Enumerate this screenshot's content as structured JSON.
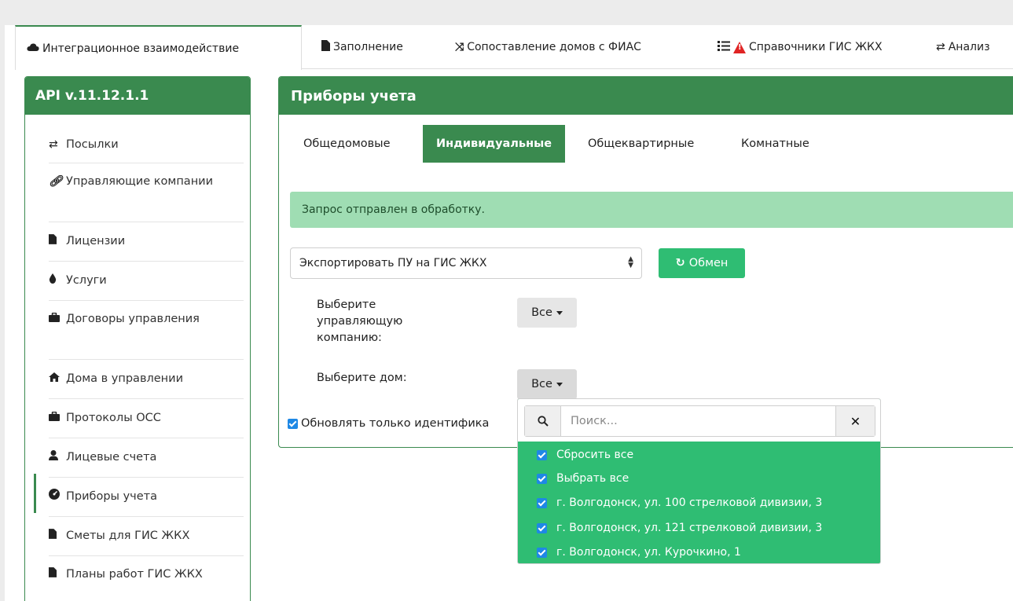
{
  "tabs": [
    {
      "label": "Интеграционное взаимодействие",
      "icon": "cloud-icon"
    },
    {
      "label": "Заполнение",
      "icon": "file-icon"
    },
    {
      "label": "Сопоставление домов с ФИАС",
      "icon": "shuffle-icon"
    },
    {
      "label": "Справочники ГИС ЖКХ",
      "icon": "list-warning-icon"
    },
    {
      "label": "Анализ",
      "icon": "exchange-icon"
    }
  ],
  "sidebar": {
    "title": "API v.11.12.1.1",
    "items": [
      {
        "label": "Посылки",
        "icon": "exchange-icon"
      },
      {
        "label": "Управляющие компании",
        "icon": "link-icon"
      },
      {
        "label": "Лицензии",
        "icon": "file-icon"
      },
      {
        "label": "Услуги",
        "icon": "drop-icon"
      },
      {
        "label": "Договоры управления",
        "icon": "briefcase-icon"
      },
      {
        "label": "Дома в управлении",
        "icon": "home-icon"
      },
      {
        "label": "Протоколы ОСС",
        "icon": "briefcase-icon"
      },
      {
        "label": "Лицевые счета",
        "icon": "user-icon"
      },
      {
        "label": "Приборы учета",
        "icon": "gauge-icon"
      },
      {
        "label": "Сметы для ГИС ЖКХ",
        "icon": "file-icon"
      },
      {
        "label": "Планы работ ГИС ЖКХ",
        "icon": "file-icon"
      }
    ]
  },
  "main": {
    "title": "Приборы учета",
    "subtabs": [
      {
        "label": "Общедомовые"
      },
      {
        "label": "Индивидуальные"
      },
      {
        "label": "Общеквартирные"
      },
      {
        "label": "Комнатные"
      }
    ],
    "alert": "Запрос отправлен в обработку.",
    "select_value": "Экспортировать ПУ на ГИС ЖКХ",
    "exchange_button": "Обмен",
    "company_label": "Выберите управляющую компанию:",
    "company_value": "Все",
    "house_label": "Выберите дом:",
    "house_value": "Все",
    "checkbox_label": "Обновлять только идентифика"
  },
  "dropdown": {
    "search_placeholder": "Поиск...",
    "items": [
      {
        "label": "Сбросить все"
      },
      {
        "label": "Выбрать все"
      },
      {
        "label": "г. Волгодонск, ул. 100 стрелковой дивизии, 3"
      },
      {
        "label": "г. Волгодонск, ул. 121 стрелковой дивизии, 3"
      },
      {
        "label": "г. Волгодонск, ул. Курочкино, 1"
      }
    ]
  },
  "colors": {
    "primary": "#3a8a4f",
    "accent": "#2fbd73",
    "alert_bg": "#9fddb3",
    "checkbox": "#1e88e5",
    "warning": "#e02424"
  }
}
